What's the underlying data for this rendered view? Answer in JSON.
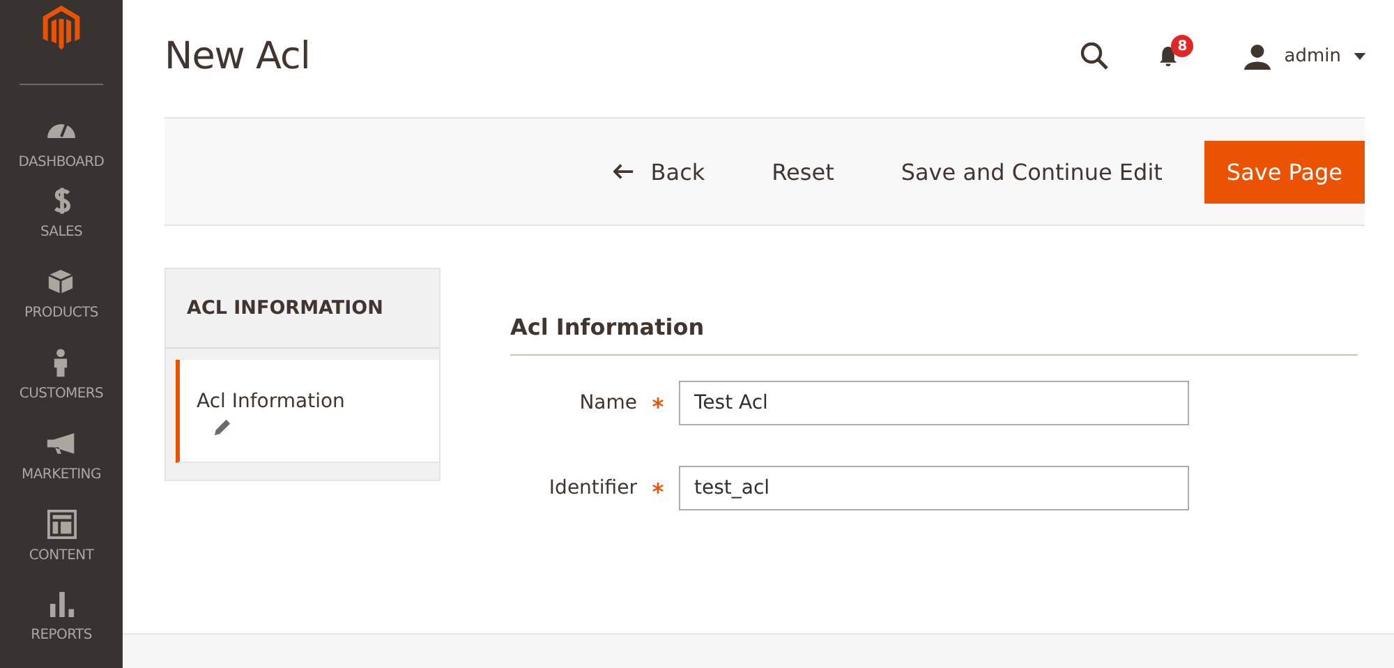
{
  "nav": [
    {
      "label": "DASHBOARD",
      "kind": "dashboard"
    },
    {
      "label": "SALES",
      "kind": "sales"
    },
    {
      "label": "PRODUCTS",
      "kind": "products"
    },
    {
      "label": "CUSTOMERS",
      "kind": "customers"
    },
    {
      "label": "MARKETING",
      "kind": "marketing"
    },
    {
      "label": "CONTENT",
      "kind": "content"
    },
    {
      "label": "REPORTS",
      "kind": "reports"
    }
  ],
  "page_title": "New Acl",
  "notifications": "8",
  "user": "admin",
  "actions": {
    "back": "Back",
    "reset": "Reset",
    "save_continue": "Save and Continue Edit",
    "save": "Save Page"
  },
  "tabs_panel": {
    "title": "ACL INFORMATION",
    "items": [
      {
        "label": "Acl Information",
        "selected": true
      }
    ]
  },
  "section_title": "Acl Information",
  "fields": [
    {
      "label": "Name",
      "required": true,
      "value": "Test Acl"
    },
    {
      "label": "Identifier",
      "required": true,
      "value": "test_acl"
    }
  ]
}
